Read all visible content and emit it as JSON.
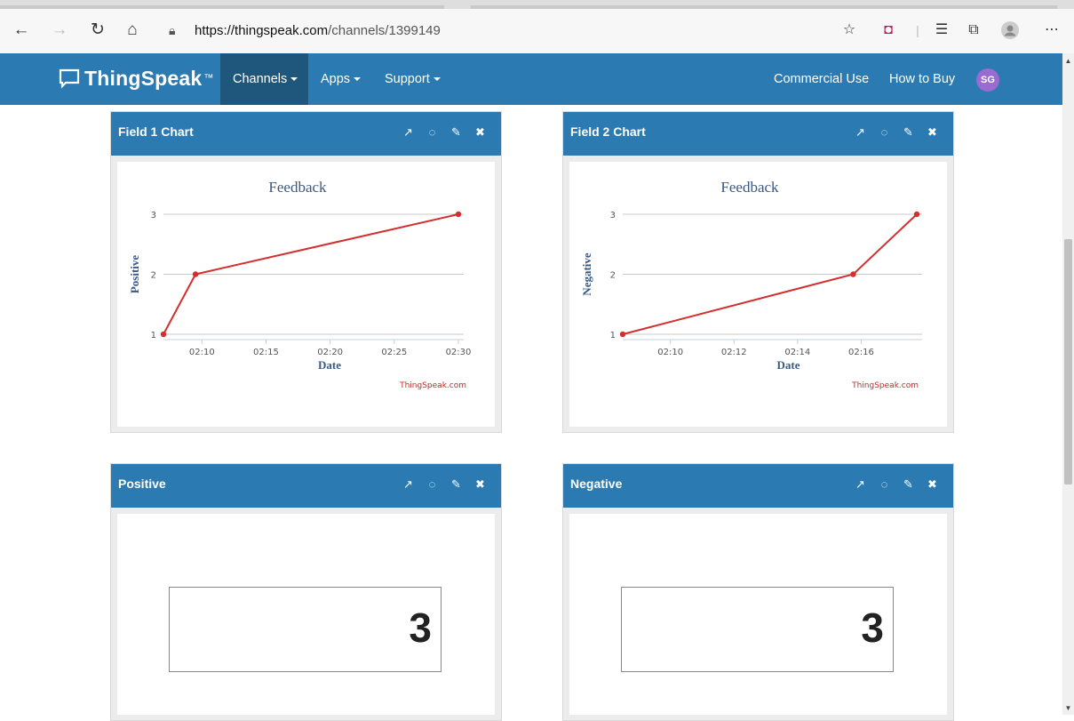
{
  "browser": {
    "url_host": "https://thingspeak.com",
    "url_path": "/channels/1399149"
  },
  "navbar": {
    "brand": "ThingSpeak",
    "brand_tm": "™",
    "items": [
      {
        "label": "Channels",
        "active": true
      },
      {
        "label": "Apps"
      },
      {
        "label": "Support"
      }
    ],
    "right_links": [
      "Commercial Use",
      "How to Buy"
    ],
    "avatar_initials": "SG"
  },
  "panels": {
    "field1": {
      "title": "Field 1 Chart"
    },
    "field2": {
      "title": "Field 2 Chart"
    },
    "positive": {
      "title": "Positive",
      "value": "3"
    },
    "negative": {
      "title": "Negative",
      "value": "3"
    }
  },
  "chart_data": [
    {
      "type": "line",
      "title": "Feedback",
      "xlabel": "Date",
      "ylabel": "Positive",
      "x_ticks": [
        "02:10",
        "02:15",
        "02:20",
        "02:25",
        "02:30"
      ],
      "y_ticks": [
        "1",
        "2",
        "3"
      ],
      "x": [
        "02:07",
        "02:09:30",
        "02:30"
      ],
      "values": [
        1,
        2,
        3
      ],
      "ylim": [
        1,
        3
      ],
      "credit": "ThingSpeak.com",
      "line_color": "#d32f2f"
    },
    {
      "type": "line",
      "title": "Feedback",
      "xlabel": "Date",
      "ylabel": "Negative",
      "x_ticks": [
        "02:10",
        "02:12",
        "02:14",
        "02:16"
      ],
      "y_ticks": [
        "1",
        "2",
        "3"
      ],
      "x": [
        "02:08:30",
        "02:15:45",
        "02:17:45"
      ],
      "values": [
        1,
        2,
        3
      ],
      "ylim": [
        1,
        3
      ],
      "credit": "ThingSpeak.com",
      "line_color": "#d32f2f"
    }
  ]
}
